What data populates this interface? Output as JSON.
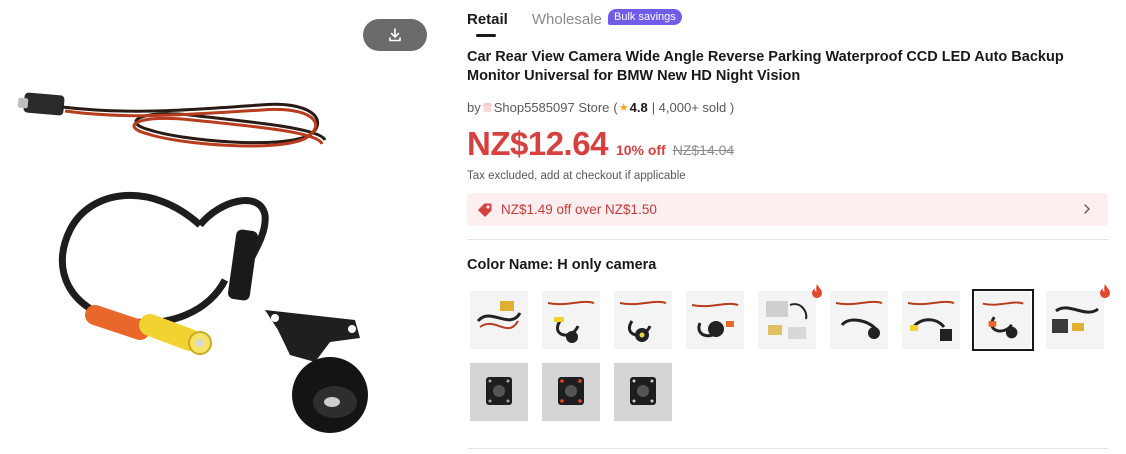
{
  "tabs": {
    "retail": "Retail",
    "wholesale": "Wholesale",
    "bulk_badge": "Bulk savings"
  },
  "product": {
    "title": "Car Rear View Camera Wide Angle Reverse Parking Waterproof CCD LED Auto Backup Monitor Universal for BMW New HD Night Vision"
  },
  "store": {
    "by": "by",
    "name": "Shop5585097 Store",
    "open_paren": "(",
    "rating": "4.8",
    "sold": "| 4,000+ sold )"
  },
  "pricing": {
    "price": "NZ$12.64",
    "discount": "10% off",
    "original_price": "NZ$14.04",
    "tax_note": "Tax excluded, add at checkout if applicable"
  },
  "coupon": {
    "text": "NZ$1.49 off over NZ$1.50"
  },
  "color": {
    "label": "Color Name: H only camera",
    "selected_index": 7,
    "hot_indices": [
      4,
      8
    ],
    "option_count": 12
  },
  "icons": {
    "download": "download-icon",
    "coupon": "tag-icon",
    "chevron": "chevron-right-icon",
    "store": "store-icon",
    "star": "star-icon",
    "hot": "flame-icon"
  },
  "colors": {
    "price_red": "#d6403e",
    "badge_purple": "#6f5ce8",
    "coupon_bg": "#fdefef",
    "star_gold": "#f5a623"
  }
}
